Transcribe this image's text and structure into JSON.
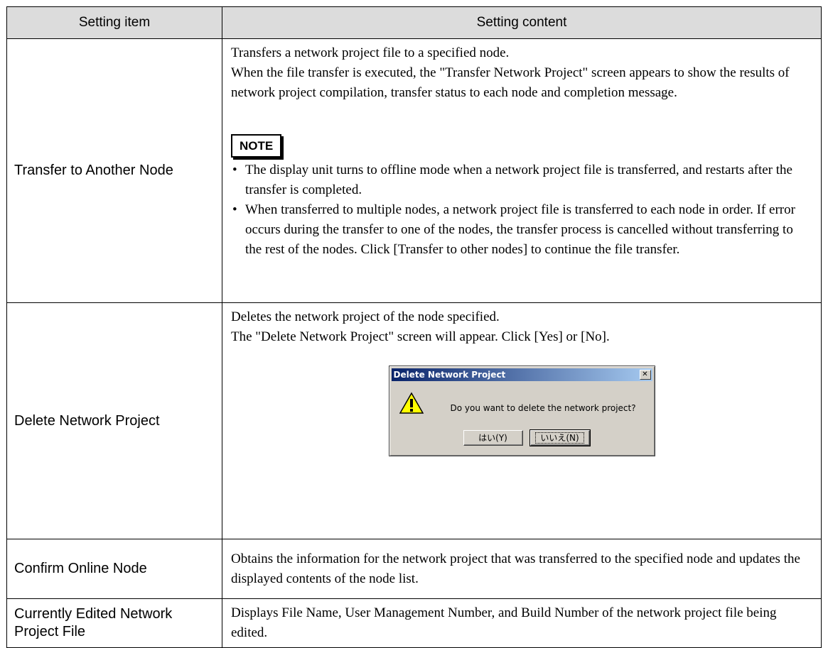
{
  "table": {
    "headers": {
      "item": "Setting item",
      "content": "Setting content"
    },
    "rows": [
      {
        "item": "Transfer to Another Node",
        "content_lines": [
          "Transfers a network project file to a specified node.",
          "When the file transfer is executed, the \"Transfer Network Project\" screen appears to show the results of network project compilation, transfer status to each node and completion message."
        ],
        "note_label": "NOTE",
        "note_bullets": [
          "The display unit turns to offline mode when a network project file is transferred, and restarts after the transfer is completed.",
          "When transferred to multiple nodes, a network project file is transferred to each node in order. If error occurs during the transfer to one of the nodes, the transfer process is cancelled without transferring to the rest of the nodes. Click [Transfer to other nodes] to continue the file transfer."
        ]
      },
      {
        "item": "Delete Network Project",
        "content_lines": [
          "Deletes the network project of the node specified.",
          "The \"Delete Network Project\" screen will appear. Click [Yes] or [No]."
        ],
        "dialog": {
          "title": "Delete Network Project",
          "close_glyph": "✕",
          "message": "Do you want to delete the network project?",
          "yes_label": "はい(Y)",
          "no_label": "いいえ(N)",
          "icon": "warning-icon"
        }
      },
      {
        "item": "Confirm Online Node",
        "content": "Obtains the information for the network project that was transferred to the specified node and updates the displayed contents of the node list."
      },
      {
        "item": "Currently Edited Network Project File",
        "content": "Displays File Name, User Management Number, and Build Number of the network project file being edited."
      }
    ]
  },
  "colors": {
    "header_bg": "#dcdcdc",
    "dialog_face": "#d4d0c8",
    "title_bar": "#0a246a"
  }
}
